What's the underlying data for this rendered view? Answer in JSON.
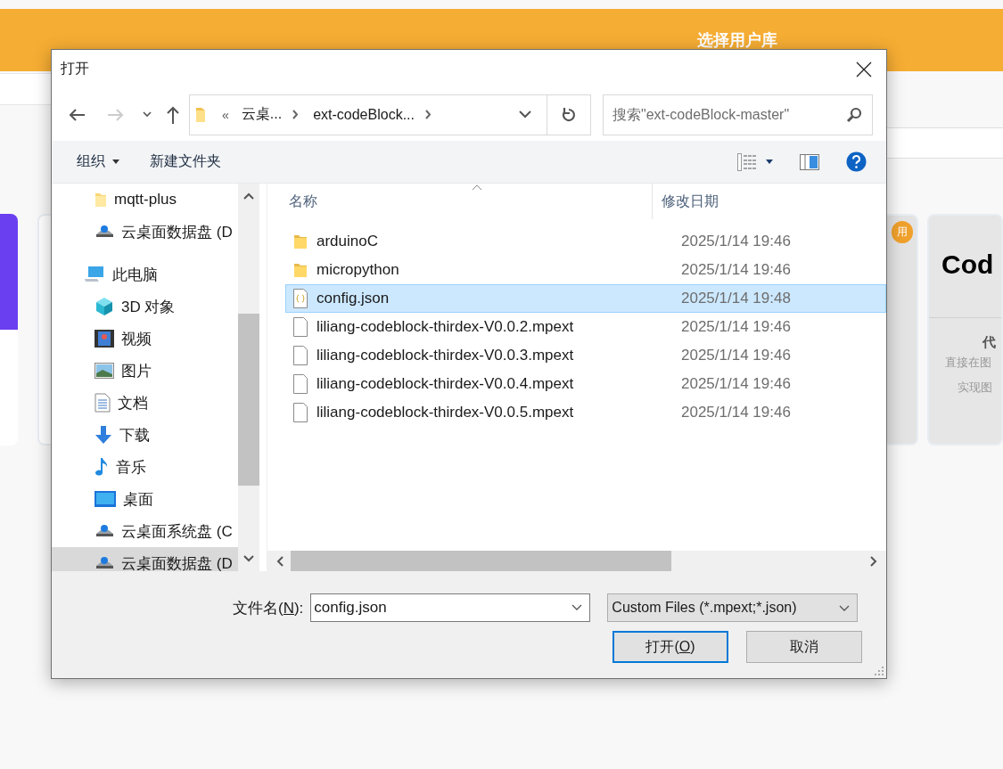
{
  "page": {
    "title": "选择用户库",
    "cards": [
      {
        "kind": "accent"
      },
      {
        "kind": "plain"
      },
      {
        "kind": "badge",
        "badge": "用"
      },
      {
        "kind": "preview",
        "logo": "Cod",
        "heading": "代",
        "lines": [
          "直接在图",
          "实现图"
        ]
      }
    ]
  },
  "dialog": {
    "title": "打开",
    "nav": {
      "back": {
        "disabled": false
      },
      "forward": {
        "disabled": true
      },
      "overflow": "«",
      "segments": [
        "云桌...",
        "ext-codeBlock..."
      ],
      "search_placeholder": "搜索\"ext-codeBlock-master\""
    },
    "toolbar": {
      "organize": "组织",
      "new_folder": "新建文件夹"
    },
    "nav_pane": {
      "quick_access": [
        {
          "label": "mqtt-plus",
          "kind": "folder",
          "selected": false
        },
        {
          "label": "云桌面数据盘 (D",
          "kind": "drive",
          "selected": false
        }
      ],
      "tree": [
        {
          "label": "此电脑",
          "kind": "computer",
          "selected": false,
          "children": [
            {
              "label": "3D 对象",
              "kind": "cube",
              "selected": false
            },
            {
              "label": "视频",
              "kind": "video",
              "selected": false
            },
            {
              "label": "图片",
              "kind": "image",
              "selected": false
            },
            {
              "label": "文档",
              "kind": "document",
              "selected": false
            },
            {
              "label": "下载",
              "kind": "download",
              "selected": false
            },
            {
              "label": "音乐",
              "kind": "music",
              "selected": false
            },
            {
              "label": "桌面",
              "kind": "desktop",
              "selected": false
            },
            {
              "label": "云桌面系统盘 (C",
              "kind": "drive",
              "selected": false
            },
            {
              "label": "云桌面数据盘 (D",
              "kind": "drive",
              "selected": true
            }
          ]
        }
      ]
    },
    "columns": [
      {
        "label": "名称",
        "sorted": true
      },
      {
        "label": "修改日期",
        "sorted": false
      }
    ],
    "files": [
      {
        "name": "arduinoC",
        "date": "2025/1/14 19:46",
        "kind": "folder",
        "selected": false
      },
      {
        "name": "micropython",
        "date": "2025/1/14 19:46",
        "kind": "folder",
        "selected": false
      },
      {
        "name": "config.json",
        "date": "2025/1/14 19:48",
        "kind": "json",
        "selected": true
      },
      {
        "name": "liliang-codeblock-thirdex-V0.0.2.mpext",
        "date": "2025/1/14 19:46",
        "kind": "file",
        "selected": false
      },
      {
        "name": "liliang-codeblock-thirdex-V0.0.3.mpext",
        "date": "2025/1/14 19:46",
        "kind": "file",
        "selected": false
      },
      {
        "name": "liliang-codeblock-thirdex-V0.0.4.mpext",
        "date": "2025/1/14 19:46",
        "kind": "file",
        "selected": false
      },
      {
        "name": "liliang-codeblock-thirdex-V0.0.5.mpext",
        "date": "2025/1/14 19:46",
        "kind": "file",
        "selected": false
      }
    ],
    "filename": {
      "label_before": "文件名(",
      "label_key": "N",
      "label_after": "):",
      "value": "config.json"
    },
    "filter": "Custom Files (*.mpext;*.json)",
    "buttons": [
      {
        "before": "打开(",
        "key": "O",
        "after": ")",
        "default": true
      },
      {
        "before": "取消",
        "default": false
      }
    ]
  }
}
